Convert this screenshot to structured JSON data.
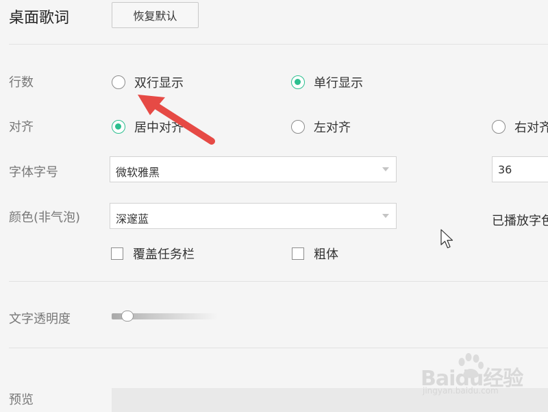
{
  "header": {
    "title": "桌面歌词",
    "restore_button": "恢复默认"
  },
  "rows": {
    "lines": {
      "label": "行数",
      "options": [
        "双行显示",
        "单行显示"
      ],
      "selected": "单行显示"
    },
    "align": {
      "label": "对齐",
      "options": [
        "居中对齐",
        "左对齐",
        "右对齐"
      ],
      "selected": "居中对齐"
    },
    "font": {
      "label": "字体字号",
      "family": "微软雅黑",
      "size": "36"
    },
    "color": {
      "label": "颜色(非气泡)",
      "value": "深邃蓝",
      "played_label": "已播放字色"
    },
    "options": {
      "cover_taskbar": {
        "label": "覆盖任务栏",
        "checked": false
      },
      "bold": {
        "label": "粗体",
        "checked": false
      }
    },
    "opacity": {
      "label": "文字透明度",
      "value_fraction": 0.1
    },
    "preview": {
      "label": "预览"
    }
  },
  "colors": {
    "accent": "#2cbf8f",
    "annotation_arrow": "#e64a45"
  },
  "watermark": {
    "logo": "Baidu经验",
    "url": "jingyan.baidu.com"
  },
  "icons": {
    "cursor": "mouse-pointer-icon",
    "annotation": "red-arrow-icon",
    "dropdown": "caret-down-icon"
  }
}
